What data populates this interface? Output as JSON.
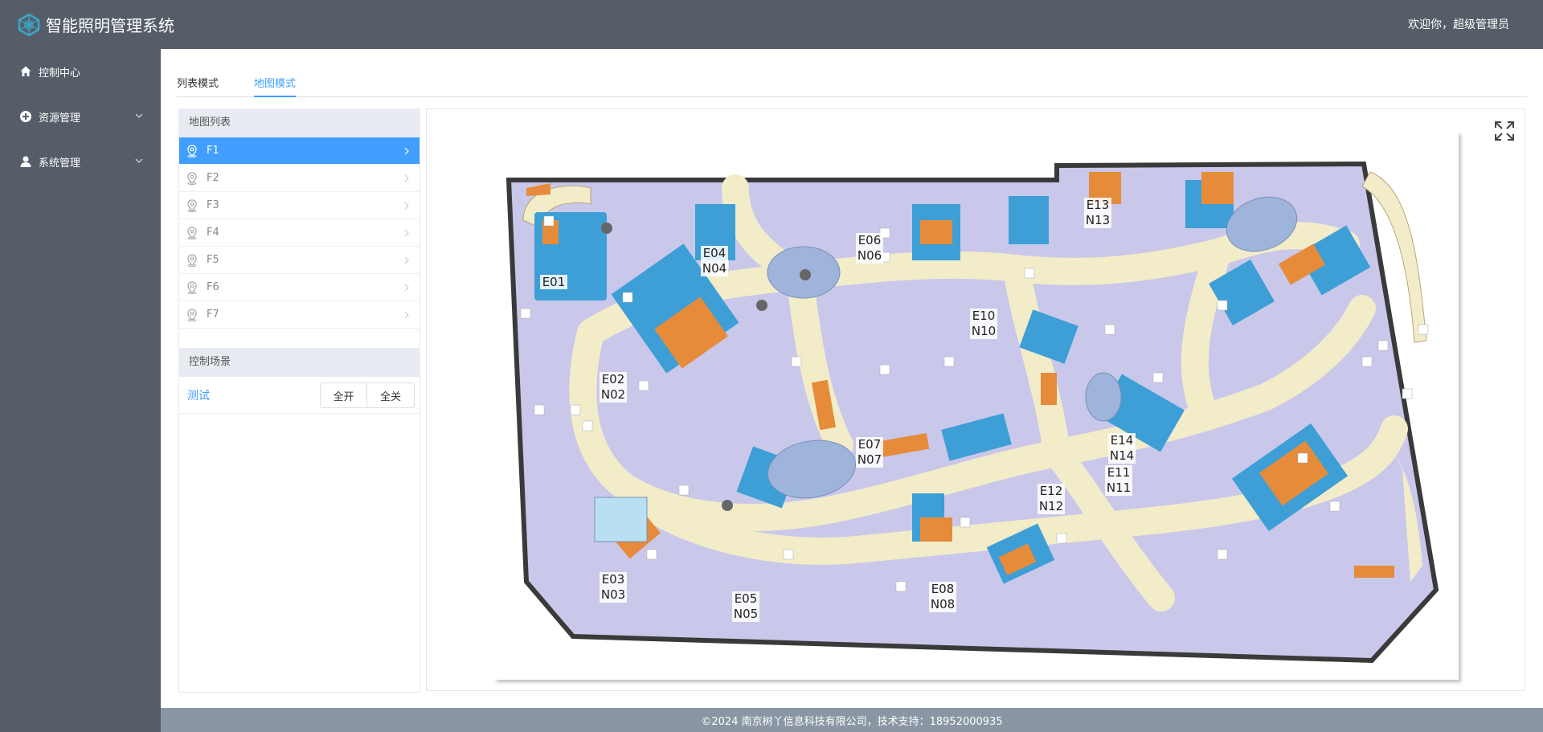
{
  "header": {
    "app_title": "智能照明管理系统",
    "welcome": "欢迎你，超级管理员"
  },
  "sidebar": {
    "items": [
      {
        "label": "控制中心",
        "icon": "home-icon"
      },
      {
        "label": "资源管理",
        "icon": "plus-circle-icon"
      },
      {
        "label": "系统管理",
        "icon": "user-icon"
      }
    ]
  },
  "tabs": [
    {
      "label": "列表模式",
      "active": false
    },
    {
      "label": "地图模式",
      "active": true
    }
  ],
  "map_list": {
    "title": "地图列表",
    "items": [
      "F1",
      "F2",
      "F3",
      "F4",
      "F5",
      "F6",
      "F7"
    ],
    "selected": "F1"
  },
  "scene_panel": {
    "title": "控制场景",
    "scenes": [
      {
        "name": "测试",
        "on_label": "全开",
        "off_label": "全关"
      }
    ]
  },
  "floor_map": {
    "zones": [
      {
        "e": "E01",
        "n": ""
      },
      {
        "e": "E02",
        "n": "N02"
      },
      {
        "e": "E03",
        "n": "N03"
      },
      {
        "e": "E04",
        "n": "N04"
      },
      {
        "e": "E05",
        "n": "N05"
      },
      {
        "e": "E06",
        "n": "N06"
      },
      {
        "e": "E07",
        "n": "N07"
      },
      {
        "e": "E08",
        "n": "N08"
      },
      {
        "e": "E10",
        "n": "N10"
      },
      {
        "e": "E11",
        "n": "N11"
      },
      {
        "e": "E12",
        "n": "N12"
      },
      {
        "e": "E13",
        "n": "N13"
      },
      {
        "e": "E14",
        "n": "N14"
      }
    ]
  },
  "footer": {
    "text": "©2024 南京树丫信息科技有限公司，技术支持：18952000935"
  },
  "colors": {
    "topbar": "#555e68",
    "accent": "#409eff",
    "footer": "#8a96a3",
    "floor_room": "#c9c8ea",
    "floor_corridor": "#f3ecc9",
    "floor_blue": "#3d9fd6",
    "floor_orange": "#e58b3a"
  }
}
